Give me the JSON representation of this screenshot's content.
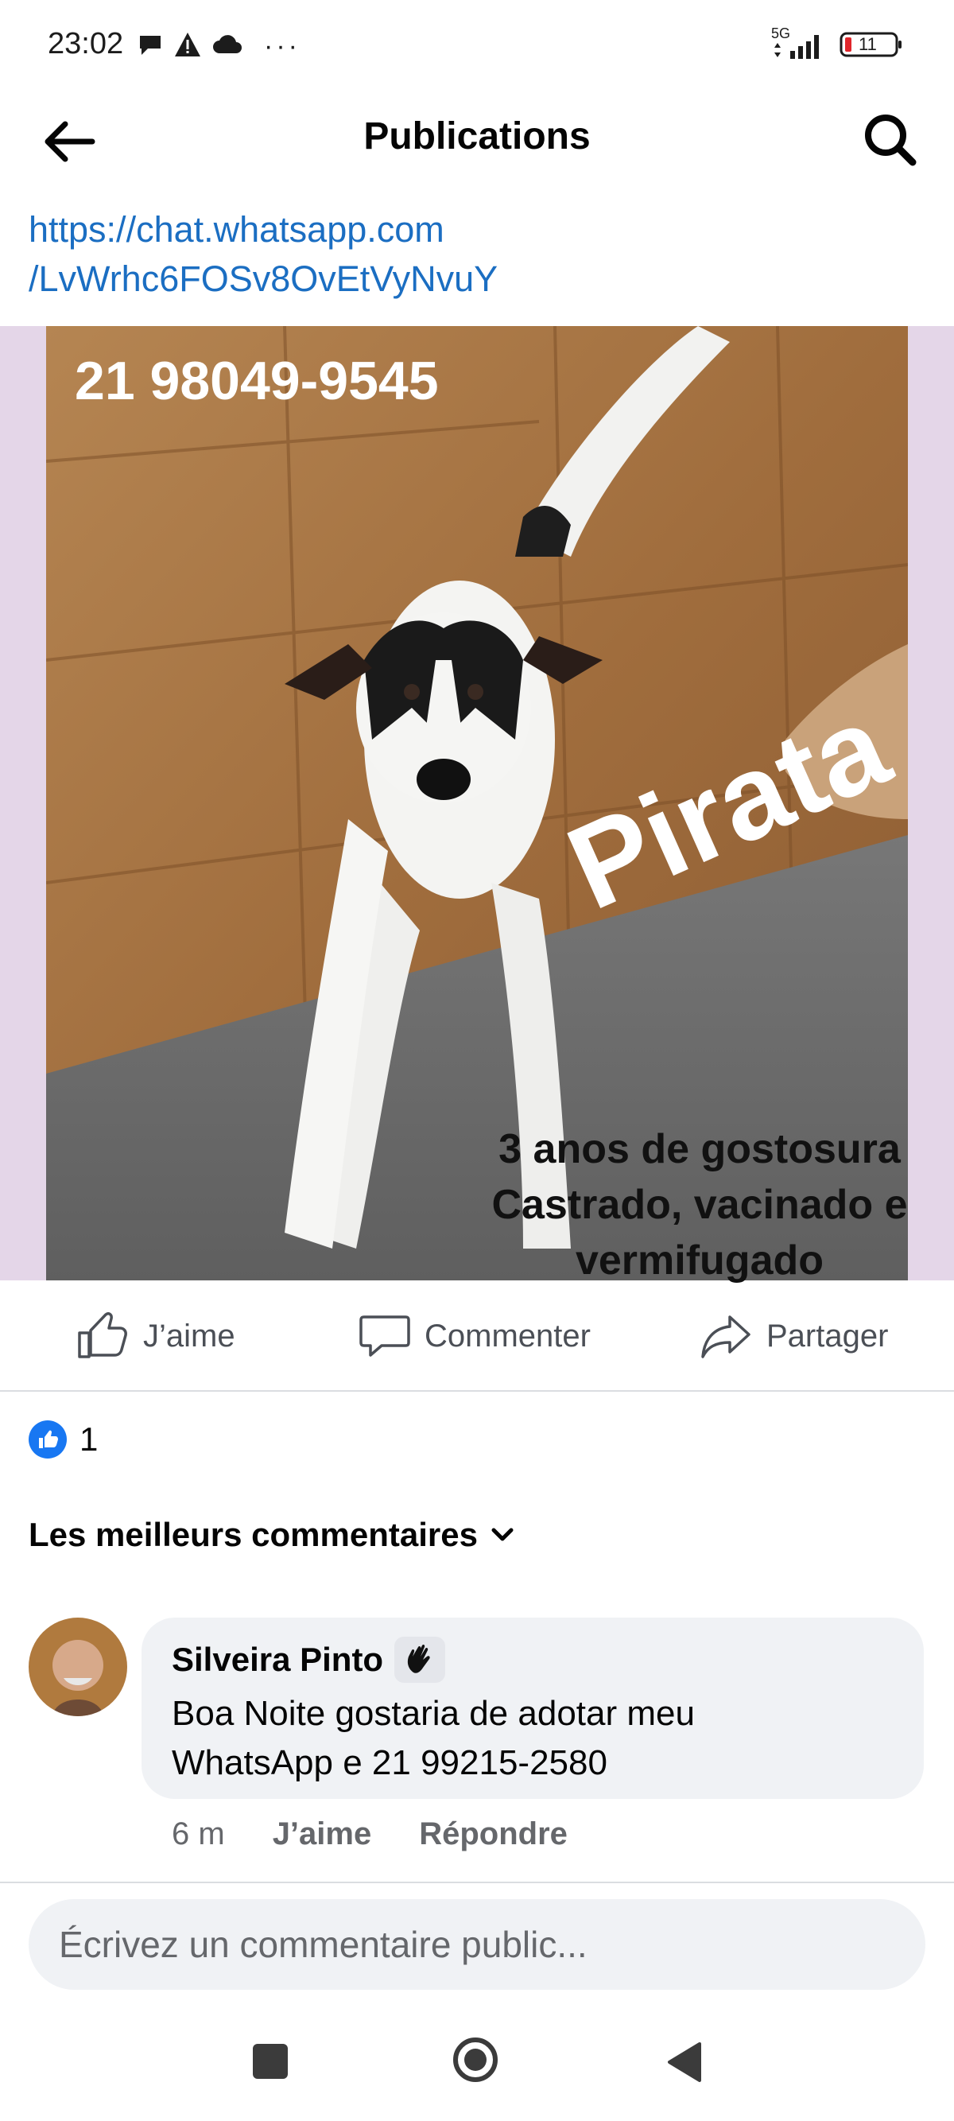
{
  "status_bar": {
    "time": "23:02",
    "more_dots": "···",
    "network": "5G",
    "battery": "11"
  },
  "header": {
    "title": "Publications"
  },
  "post": {
    "link_line1": "https://chat.whatsapp.com",
    "link_line2": "/LvWrhc6FOSv8OvEtVyNvuY",
    "image": {
      "phone_overlay": "21 98049-9545",
      "name_overlay": "Pirata",
      "caption_lines": [
        "3 anos de gostosura",
        "Castrado, vacinado e",
        "vermifugado"
      ]
    },
    "actions": {
      "like": "J’aime",
      "comment": "Commenter",
      "share": "Partager"
    },
    "reaction_count": "1"
  },
  "comments": {
    "sort_label": "Les meilleurs commentaires",
    "items": [
      {
        "author": "Silveira Pinto",
        "text_line1": "Boa Noite gostaria de adotar meu",
        "text_line2": "WhatsApp e 21 99215-2580",
        "time": "6 m",
        "like_label": "J’aime",
        "reply_label": "Répondre"
      }
    ],
    "input_placeholder": "Écrivez un commentaire public..."
  },
  "colors": {
    "link": "#1b6ec2",
    "like_blue": "#1877f2",
    "image_background": "#e4d6e8"
  }
}
